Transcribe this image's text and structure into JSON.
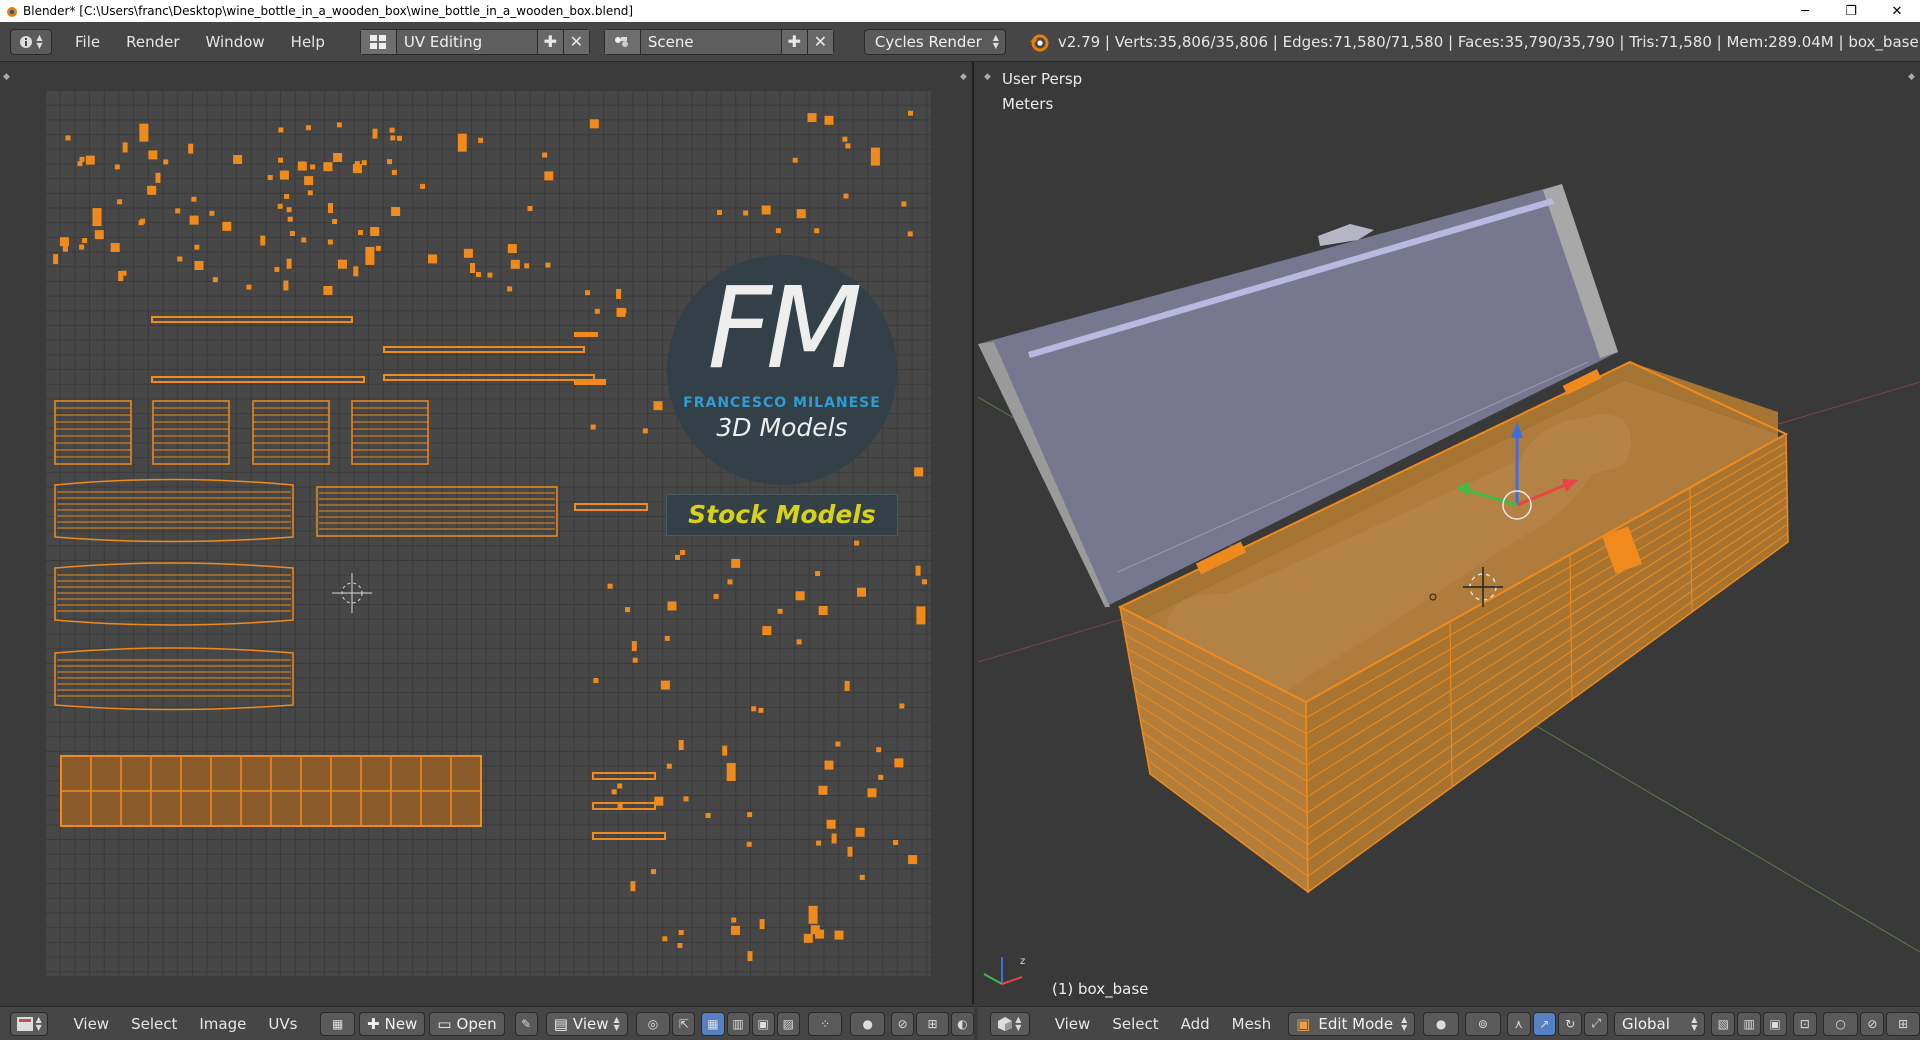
{
  "window": {
    "title": "Blender* [C:\\Users\\franc\\Desktop\\wine_bottle_in_a_wooden_box\\wine_bottle_in_a_wooden_box.blend]",
    "minimize": "─",
    "maximize": "❐",
    "close": "✕"
  },
  "info_header": {
    "menus": [
      "File",
      "Render",
      "Window",
      "Help"
    ],
    "layout": "UV Editing",
    "scene": "Scene",
    "render_engine": "Cycles Render",
    "stats": "v2.79 | Verts:35,806/35,806 | Edges:71,580/71,580 | Faces:35,790/35,790 | Tris:71,580 | Mem:289.04M | box_base"
  },
  "uv_editor": {
    "watermark": {
      "initials": "FM",
      "author": "FRANCESCO MILANESE",
      "tagline": "3D Models",
      "banner": "Stock Models"
    },
    "footer": {
      "menus": [
        "View",
        "Select",
        "Image",
        "UVs"
      ],
      "new_label": "New",
      "open_label": "Open",
      "view_label": "View"
    }
  },
  "viewport": {
    "view_name": "User Persp",
    "units": "Meters",
    "object_label": "(1) box_base",
    "footer": {
      "menus": [
        "View",
        "Select",
        "Add",
        "Mesh"
      ],
      "mode": "Edit Mode",
      "orientation": "Global"
    }
  },
  "colors": {
    "uv_selected": "#f08a1c",
    "accent_blue": "#5680c2",
    "watermark_blue": "#2ea0d8",
    "watermark_yellow": "#d6d21c"
  }
}
